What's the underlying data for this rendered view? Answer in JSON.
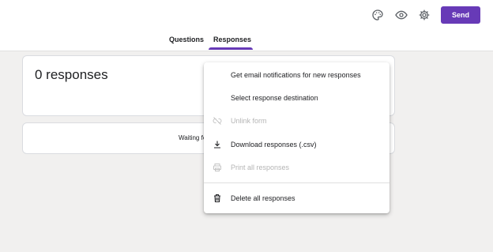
{
  "toolbar": {
    "icons": [
      "palette-icon",
      "eye-icon",
      "gear-icon"
    ],
    "send_label": "Send"
  },
  "tabs": [
    {
      "label": "Questions",
      "active": false
    },
    {
      "label": "Responses",
      "active": true
    }
  ],
  "summary_card": {
    "title": "0 responses"
  },
  "waiting_card": {
    "text": "Waiting fo"
  },
  "menu": {
    "items": [
      {
        "label": "Get email notifications for new responses",
        "icon": "none",
        "enabled": true
      },
      {
        "label": "Select response destination",
        "icon": "none",
        "enabled": true
      },
      {
        "label": "Unlink form",
        "icon": "unlink-icon",
        "enabled": false
      },
      {
        "label": "Download responses (.csv)",
        "icon": "download-icon",
        "enabled": true
      },
      {
        "label": "Print all responses",
        "icon": "print-icon",
        "enabled": false
      },
      {
        "label": "Delete all responses",
        "icon": "trash-icon",
        "enabled": true
      }
    ]
  },
  "colors": {
    "accent": "#673ab7",
    "background": "#f1f0ef",
    "disabled_text": "#b5b5b5"
  }
}
